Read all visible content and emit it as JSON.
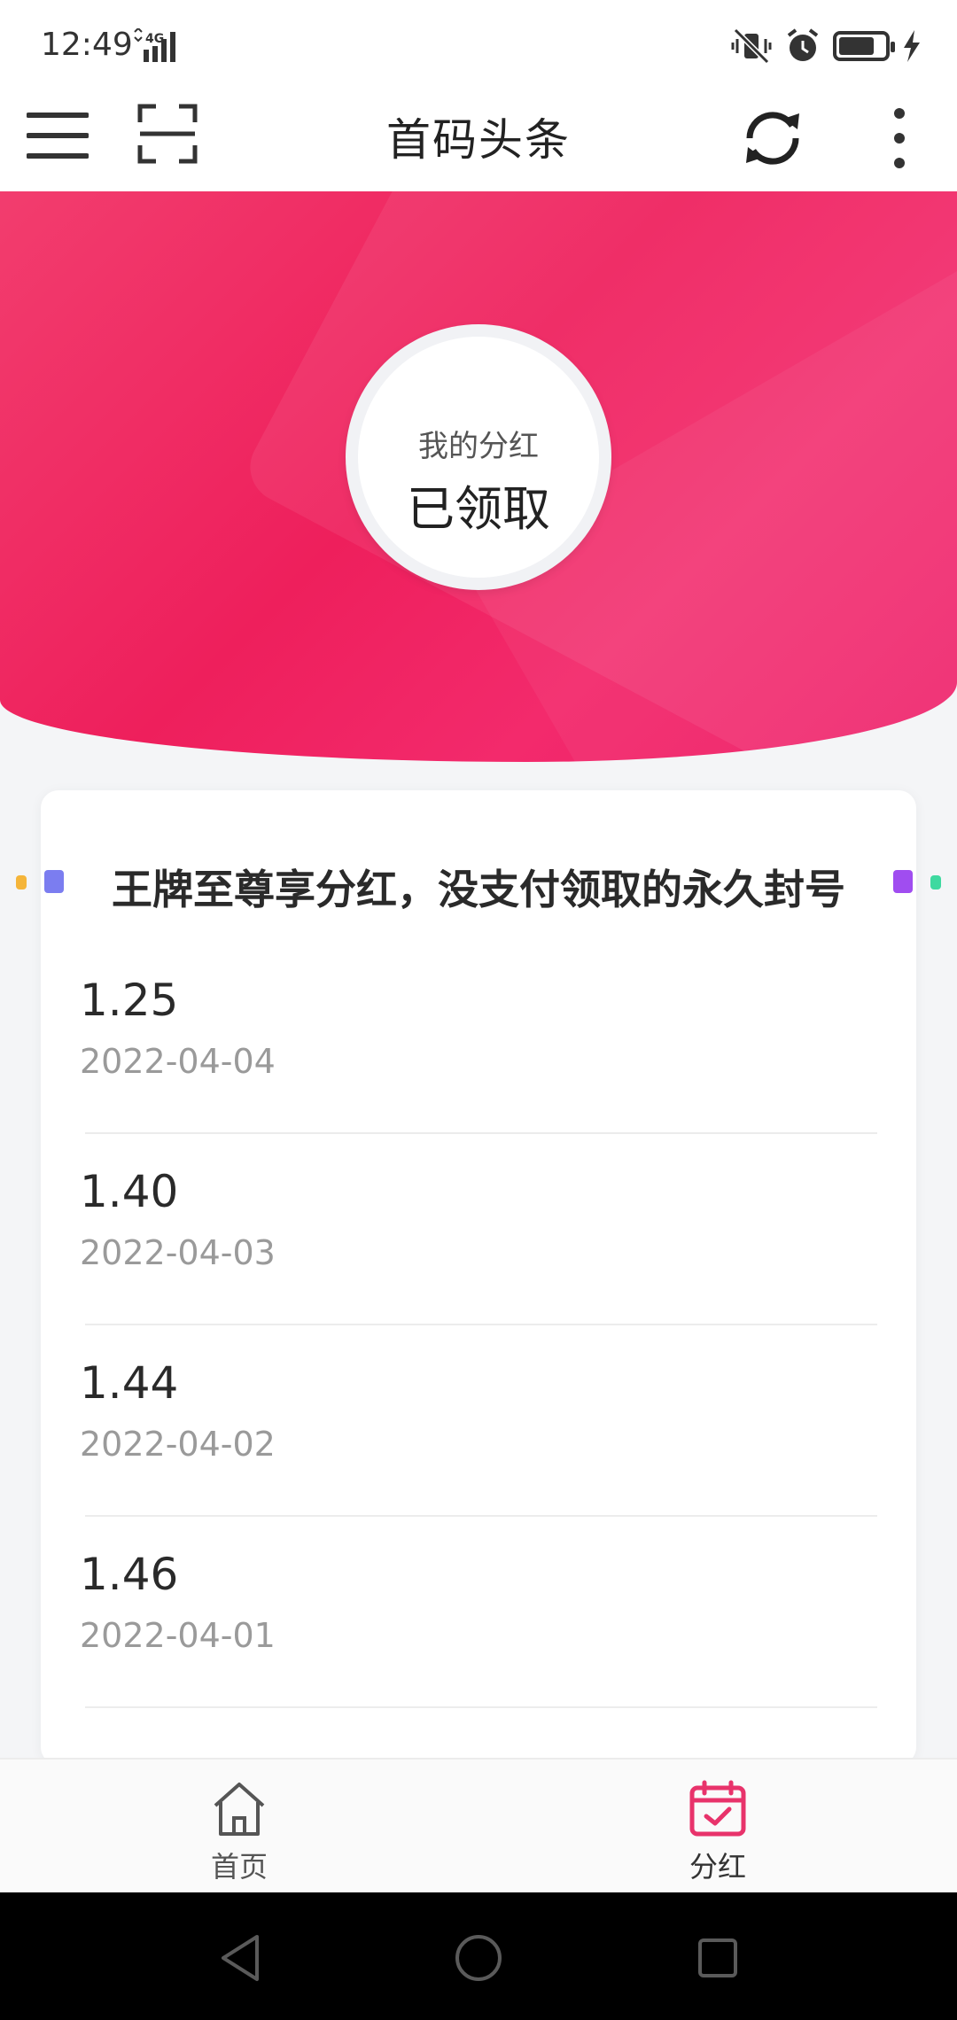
{
  "status_bar": {
    "time": "12:49",
    "network": "4G",
    "icons": [
      "vibrate-off-icon",
      "alarm-icon",
      "battery-icon",
      "charging-icon"
    ]
  },
  "app_bar": {
    "title": "首码头条",
    "icons": [
      "menu-icon",
      "scan-icon",
      "refresh-icon",
      "more-icon"
    ]
  },
  "hero": {
    "label": "我的分红",
    "status": "已领取",
    "colors": {
      "primary": "#ee1f5c"
    }
  },
  "notice": {
    "text": "王牌至尊享分红，没支付领取的永久封号"
  },
  "records": [
    {
      "amount": "1.25",
      "date": "2022-04-04"
    },
    {
      "amount": "1.40",
      "date": "2022-04-03"
    },
    {
      "amount": "1.44",
      "date": "2022-04-02"
    },
    {
      "amount": "1.46",
      "date": "2022-04-01"
    }
  ],
  "bottom_nav": {
    "items": [
      {
        "label": "首页",
        "icon": "home-icon",
        "active": false
      },
      {
        "label": "分红",
        "icon": "calendar-check-icon",
        "active": true
      }
    ],
    "active_color": "#e8336b",
    "inactive_color": "#555555"
  }
}
